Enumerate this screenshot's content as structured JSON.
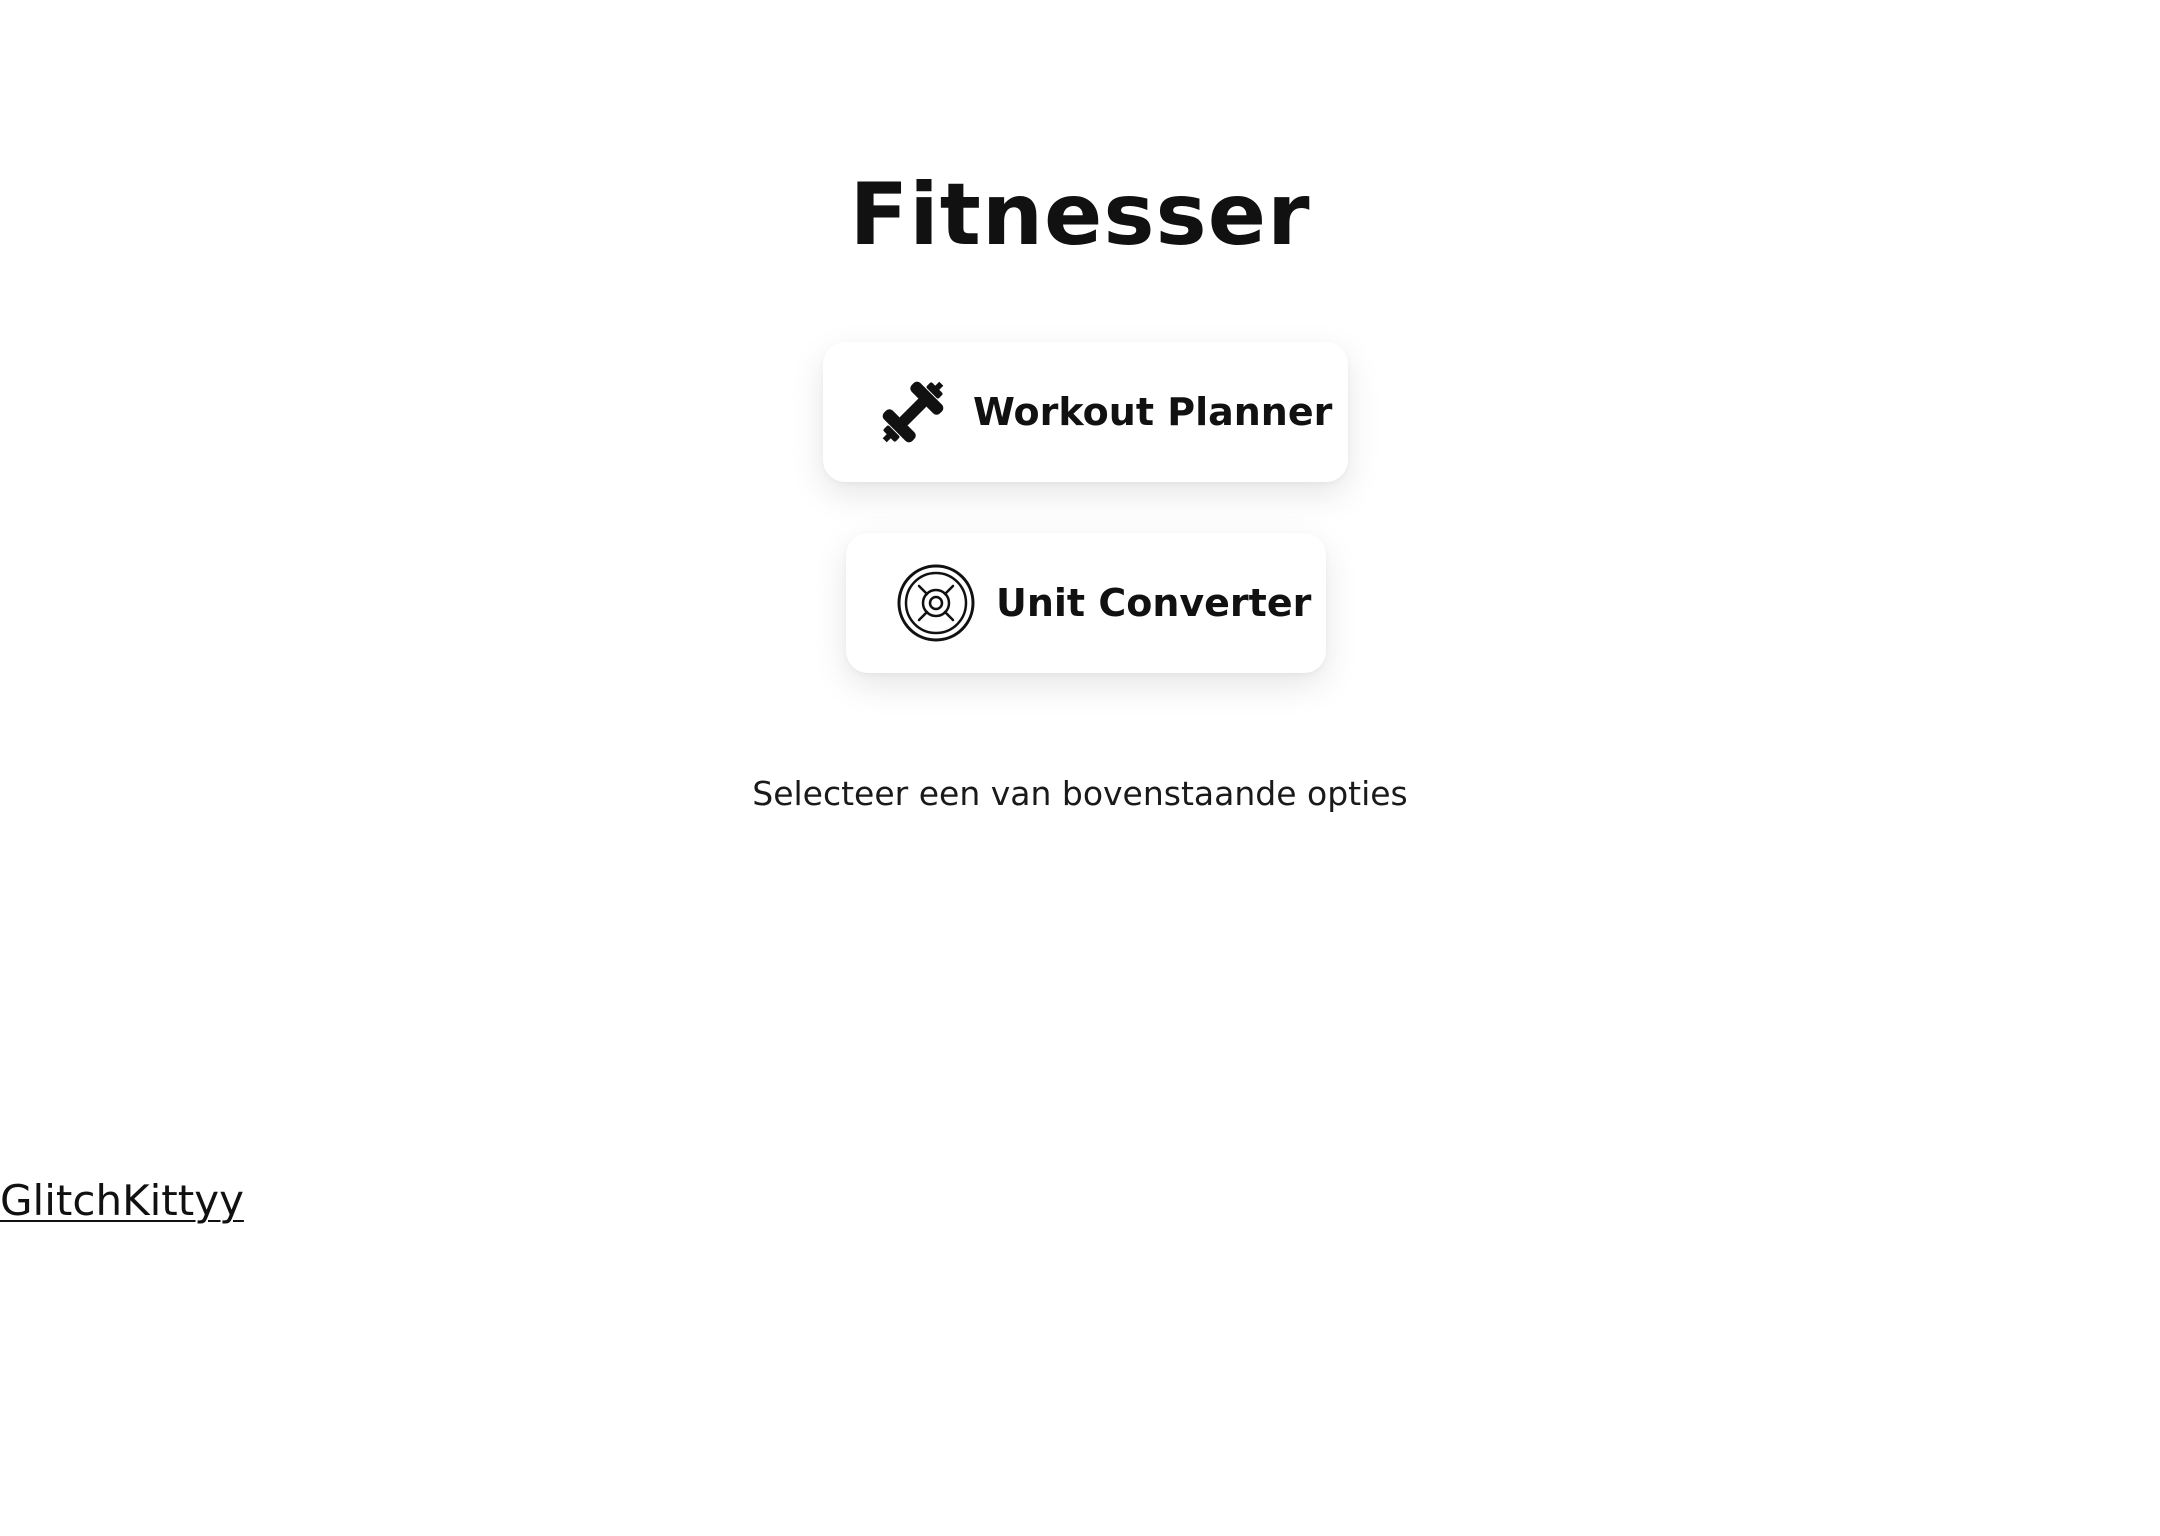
{
  "app": {
    "title": "Fitnesser"
  },
  "options": [
    {
      "label": "Workout Planner",
      "icon": "dumbbell-icon"
    },
    {
      "label": "Unit Converter",
      "icon": "weight-plate-icon"
    }
  ],
  "subtitle": "Selecteer een van bovenstaande opties",
  "footer": {
    "link_text": "GlitchKittyy"
  }
}
